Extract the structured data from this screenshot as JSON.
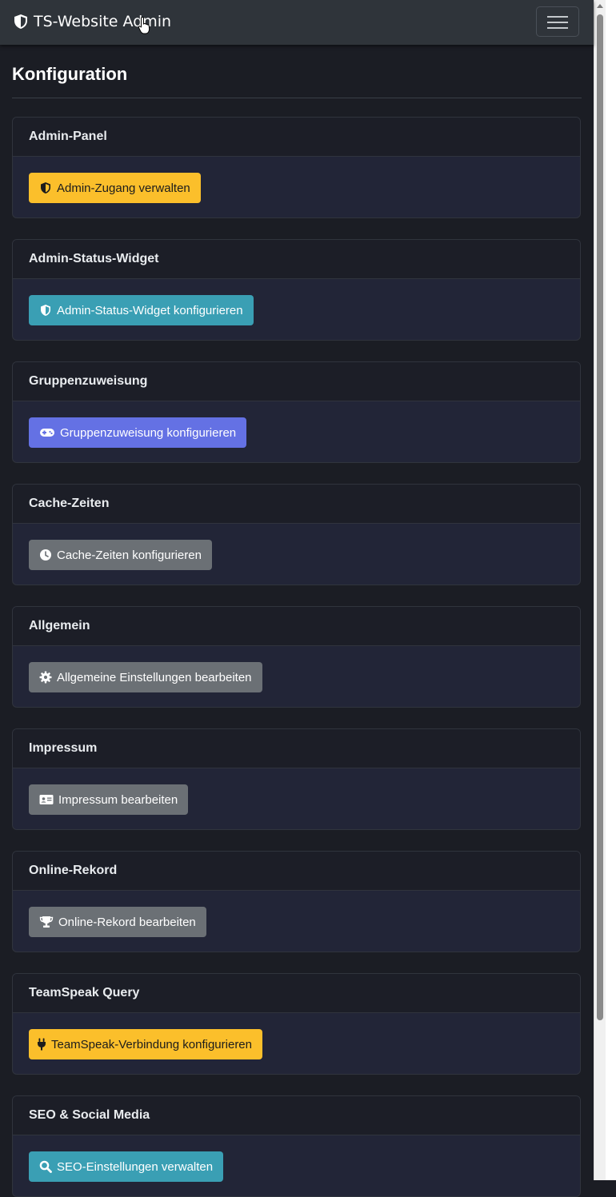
{
  "navbar": {
    "brand_title": "TS-Website Admin",
    "brand_icon": "shield-icon",
    "menu_icon": "hamburger-menu-icon"
  },
  "page": {
    "title": "Konfiguration"
  },
  "colors": {
    "warning": "#fbbf2b",
    "info": "#3a9fb4",
    "indigo": "#6471e4",
    "secondary": "#6b7075",
    "background": "#1b1d24"
  },
  "cards": [
    {
      "header": "Admin-Panel",
      "button_label": "Admin-Zugang verwalten",
      "icon": "shield-icon",
      "style": "warning"
    },
    {
      "header": "Admin-Status-Widget",
      "button_label": "Admin-Status-Widget konfigurieren",
      "icon": "shield-icon",
      "style": "info"
    },
    {
      "header": "Gruppenzuweisung",
      "button_label": "Gruppenzuweisung konfigurieren",
      "icon": "gamepad-icon",
      "style": "indigo"
    },
    {
      "header": "Cache-Zeiten",
      "button_label": "Cache-Zeiten konfigurieren",
      "icon": "clock-icon",
      "style": "secondary"
    },
    {
      "header": "Allgemein",
      "button_label": "Allgemeine Einstellungen bearbeiten",
      "icon": "gear-icon",
      "style": "secondary"
    },
    {
      "header": "Impressum",
      "button_label": "Impressum bearbeiten",
      "icon": "id-card-icon",
      "style": "secondary"
    },
    {
      "header": "Online-Rekord",
      "button_label": "Online-Rekord bearbeiten",
      "icon": "trophy-icon",
      "style": "secondary"
    },
    {
      "header": "TeamSpeak Query",
      "button_label": "TeamSpeak-Verbindung konfigurieren",
      "icon": "plug-icon",
      "style": "warning"
    },
    {
      "header": "SEO & Social Media",
      "button_label": "SEO-Einstellungen verwalten",
      "icon": "search-icon",
      "style": "info"
    }
  ]
}
